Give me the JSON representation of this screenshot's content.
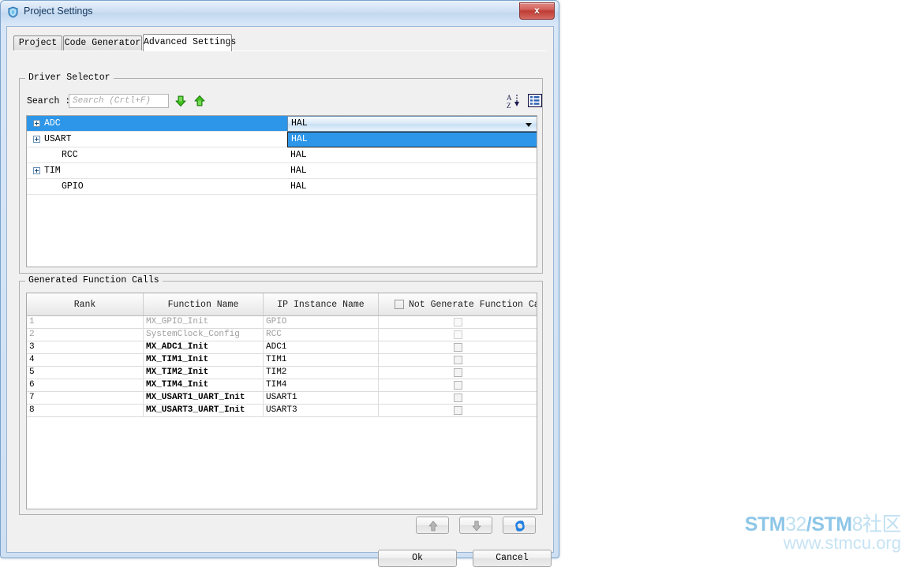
{
  "window": {
    "title": "Project Settings",
    "icon": "shield-icon",
    "close_label": "x"
  },
  "tabs": [
    {
      "label": "Project",
      "active": false
    },
    {
      "label": "Code Generator",
      "active": false
    },
    {
      "label": "Advanced Settings",
      "active": true
    }
  ],
  "driver_selector": {
    "legend": "Driver Selector",
    "search_label": "Search :",
    "search_value": "",
    "search_placeholder": "Search (Crtl+F)",
    "icons": {
      "down": "green-down-arrow-icon",
      "up": "green-up-arrow-icon",
      "sort": "sort-az-icon",
      "list": "list-view-icon"
    },
    "rows": [
      {
        "name": "ADC",
        "level": 0,
        "expandable": true,
        "selected": true,
        "value": "HAL",
        "editing": true
      },
      {
        "name": "USART",
        "level": 0,
        "expandable": true,
        "selected": false,
        "value": "HAL",
        "editing": false
      },
      {
        "name": "RCC",
        "level": 1,
        "expandable": false,
        "selected": false,
        "value": "HAL",
        "editing": false
      },
      {
        "name": "TIM",
        "level": 0,
        "expandable": true,
        "selected": false,
        "value": "HAL",
        "editing": false
      },
      {
        "name": "GPIO",
        "level": 1,
        "expandable": false,
        "selected": false,
        "value": "HAL",
        "editing": false
      }
    ],
    "combo": {
      "selected": "HAL",
      "open": true,
      "options": [
        "HAL"
      ]
    }
  },
  "generated_calls": {
    "legend": "Generated Function Calls",
    "columns": [
      "Rank",
      "Function Name",
      "IP Instance Name",
      "Not Generate Function Call"
    ],
    "header_checkbox_checked": false,
    "rows": [
      {
        "rank": "1",
        "function": "MX_GPIO_Init",
        "ip": "GPIO",
        "not_generate": false,
        "disabled": true
      },
      {
        "rank": "2",
        "function": "SystemClock_Config",
        "ip": "RCC",
        "not_generate": false,
        "disabled": true
      },
      {
        "rank": "3",
        "function": "MX_ADC1_Init",
        "ip": "ADC1",
        "not_generate": false,
        "disabled": false
      },
      {
        "rank": "4",
        "function": "MX_TIM1_Init",
        "ip": "TIM1",
        "not_generate": false,
        "disabled": false
      },
      {
        "rank": "5",
        "function": "MX_TIM2_Init",
        "ip": "TIM2",
        "not_generate": false,
        "disabled": false
      },
      {
        "rank": "6",
        "function": "MX_TIM4_Init",
        "ip": "TIM4",
        "not_generate": false,
        "disabled": false
      },
      {
        "rank": "7",
        "function": "MX_USART1_UART_Init",
        "ip": "USART1",
        "not_generate": false,
        "disabled": false
      },
      {
        "rank": "8",
        "function": "MX_USART3_UART_Init",
        "ip": "USART3",
        "not_generate": false,
        "disabled": false
      }
    ],
    "toolbar": {
      "move_up": "move-up-arrow-icon",
      "move_down": "move-down-arrow-icon",
      "refresh": "refresh-icon"
    }
  },
  "footer": {
    "ok_label": "Ok",
    "cancel_label": "Cancel"
  },
  "watermark": {
    "part1": "STM",
    "part2": "32",
    "part3": "/STM",
    "part4": "8社区",
    "line2": "www.stmcu.org"
  }
}
